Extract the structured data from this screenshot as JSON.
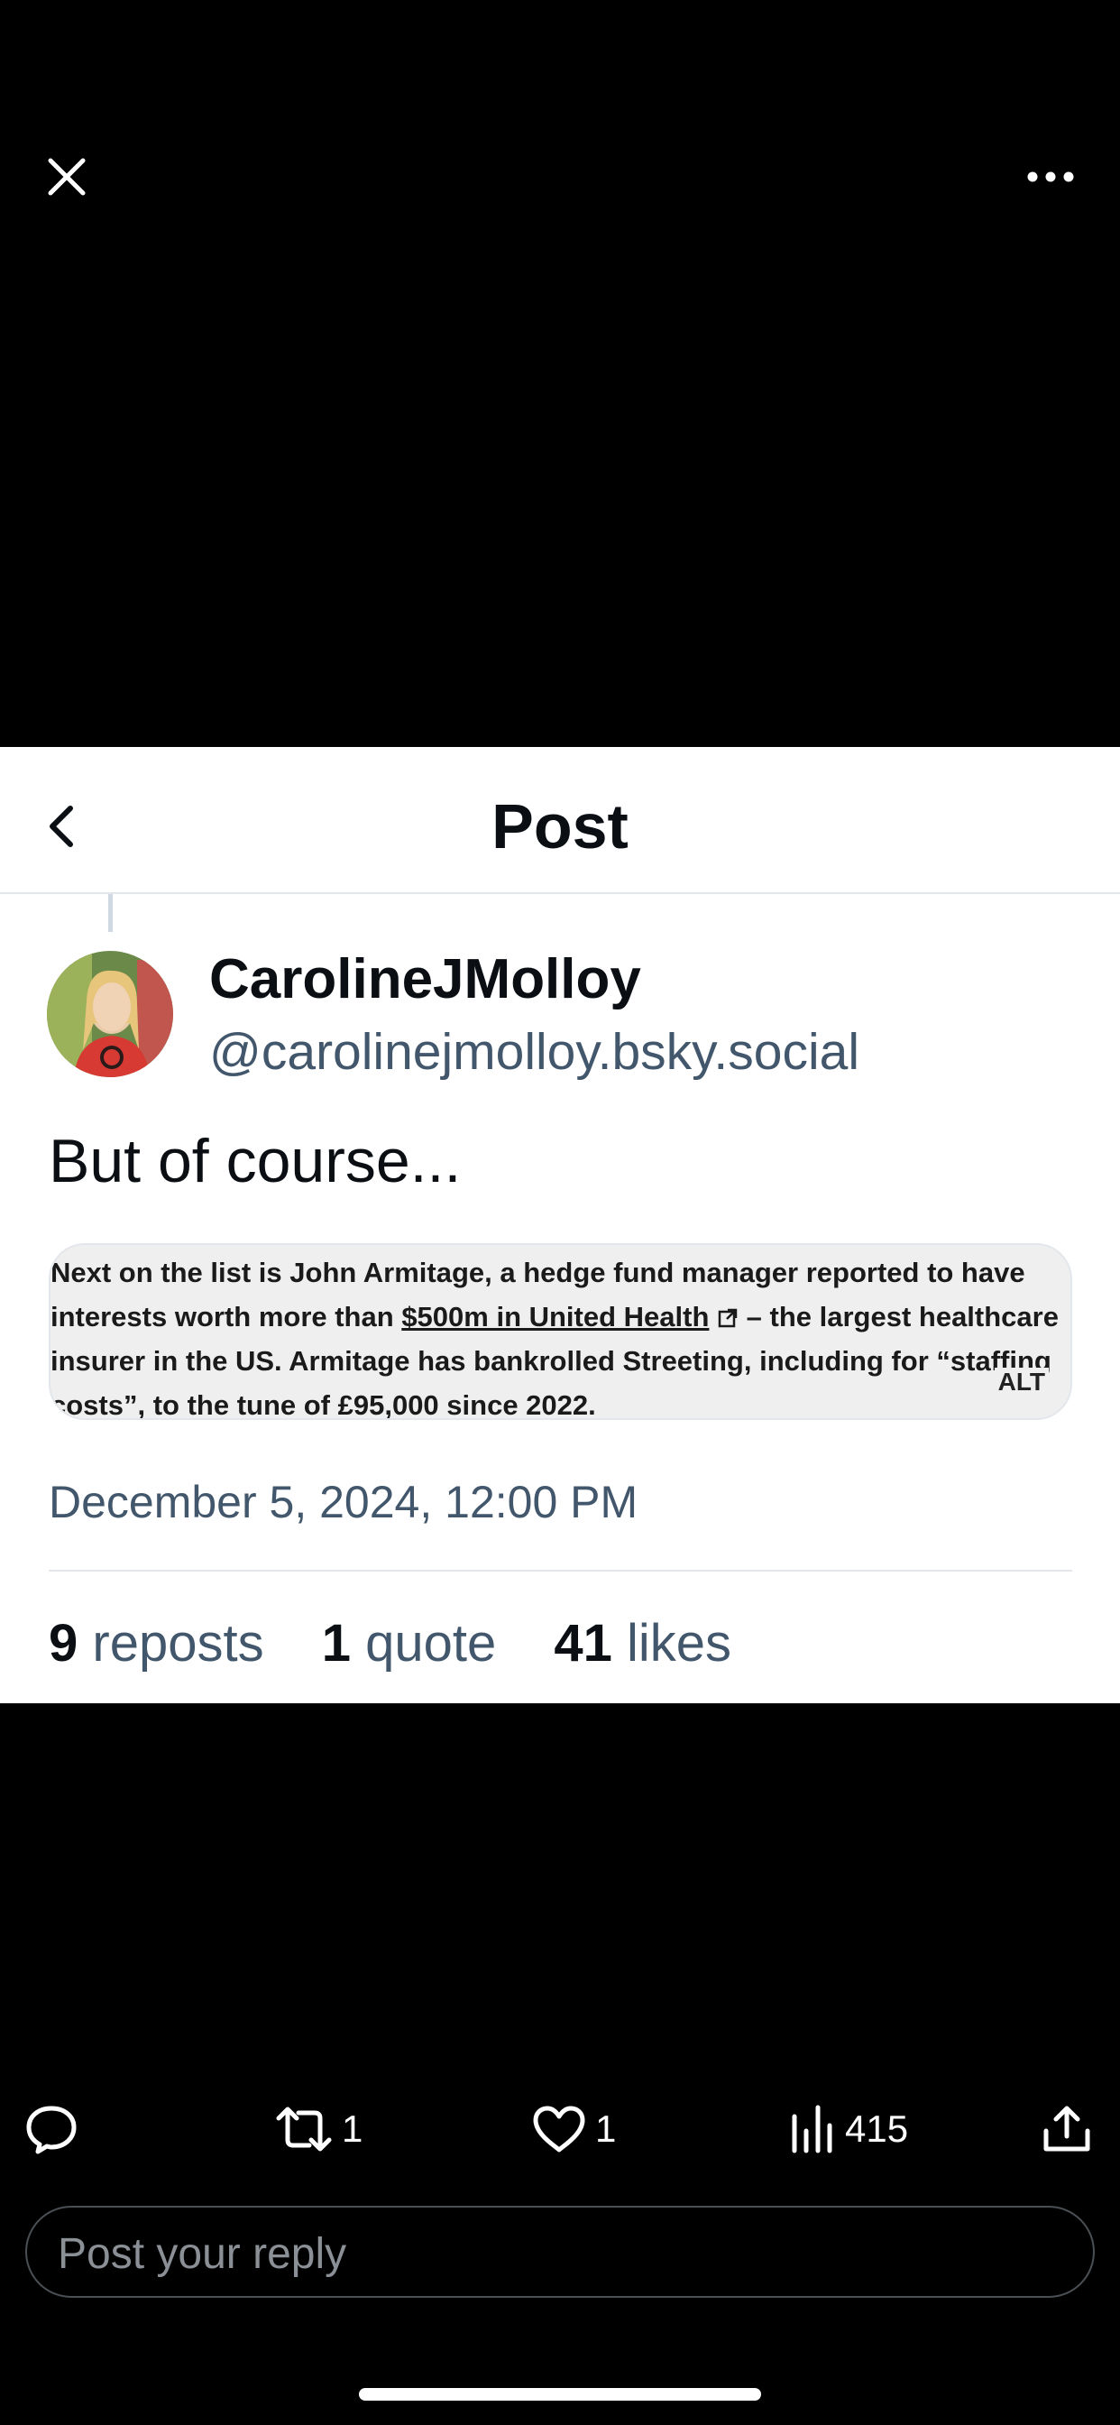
{
  "viewer": {
    "close_icon": "close-icon",
    "more_icon": "more-horizontal-icon"
  },
  "header": {
    "back_icon": "chevron-left-icon",
    "title": "Post"
  },
  "post": {
    "author": {
      "display_name": "CarolineJMolloy",
      "handle": "@carolinejmolloy.bsky.social",
      "avatar_icon": "avatar"
    },
    "text": "But of course...",
    "media": {
      "lines": [
        "Next on the list is John Armitage, a hedge fund manager reported to have",
        "interests worth more than",
        "$500m in United Health",
        "– the largest healthcare",
        "insurer in the US. Armitage has bankrolled Streeting, including for “staffing",
        "costs”, to the tune of £95,000 since 2022."
      ],
      "alt_label": "ALT"
    },
    "timestamp": "December 5, 2024, 12:00 PM",
    "stats": {
      "reposts_count": "9",
      "reposts_label": "reposts",
      "quotes_count": "1",
      "quotes_label": "quote",
      "likes_count": "41",
      "likes_label": "likes"
    }
  },
  "actions": {
    "reply_icon": "reply-icon",
    "repost_count": "1",
    "like_count": "1",
    "views_count": "415",
    "share_icon": "share-icon"
  },
  "reply": {
    "placeholder": "Post your reply"
  },
  "colors": {
    "background": "#000000",
    "card": "#ffffff",
    "secondary_text": "#42576c",
    "primary_text": "#0b0f14"
  }
}
